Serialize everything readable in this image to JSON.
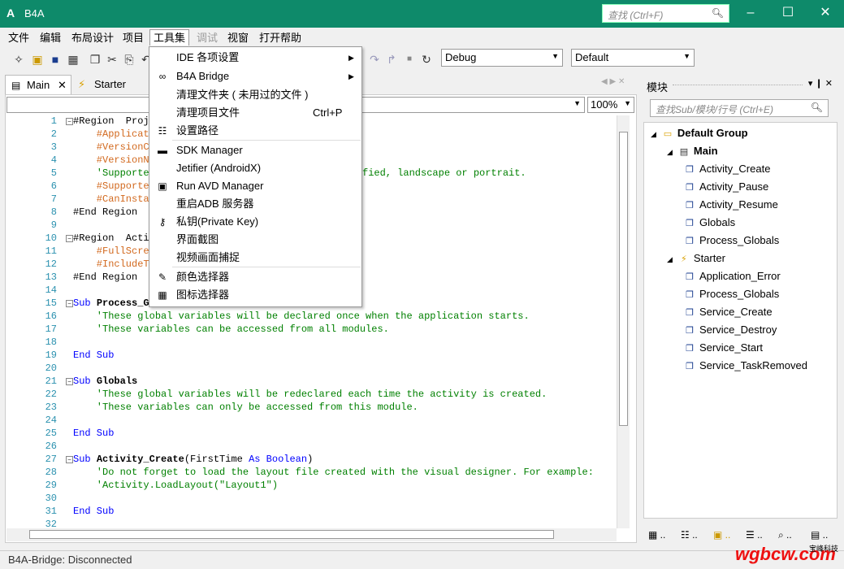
{
  "window": {
    "title": "B4A",
    "app_icon": "A",
    "search_placeholder": "查找 (Ctrl+F)",
    "titlebar_color": "#0e8a6a"
  },
  "menu": [
    "文件",
    "编辑",
    "布局设计",
    "项目",
    "工具集",
    "调试",
    "视窗",
    "打开帮助"
  ],
  "toolbar": {
    "config_combo": "Debug",
    "target_combo": "Default"
  },
  "tabs": {
    "main": "Main",
    "starter": "Starter"
  },
  "editor": {
    "zoom": "100%",
    "line_numbers": [
      "1",
      "2",
      "3",
      "4",
      "5",
      "6",
      "7",
      "8",
      "9",
      "10",
      "11",
      "12",
      "13",
      "14",
      "15",
      "16",
      "17",
      "18",
      "19",
      "20",
      "21",
      "22",
      "23",
      "24",
      "25",
      "26",
      "27",
      "28",
      "29",
      "30",
      "31",
      "32"
    ],
    "lines": [
      {
        "n": 1,
        "parts": [
          [
            "#Region  Proje",
            "c-dir"
          ]
        ]
      },
      {
        "n": 2,
        "parts": [
          [
            "    #Applicat",
            "c-attr"
          ]
        ]
      },
      {
        "n": 3,
        "parts": [
          [
            "    #VersionCo",
            "c-attr"
          ]
        ]
      },
      {
        "n": 4,
        "parts": [
          [
            "    #VersionNa",
            "c-attr"
          ]
        ]
      },
      {
        "n": 5,
        "parts": [
          [
            "    'Supportec",
            "c-comment"
          ]
        ]
      },
      {
        "n": 6,
        "parts": [
          [
            "    #Supportec",
            "c-attr"
          ]
        ]
      },
      {
        "n": 7,
        "parts": [
          [
            "    #CanInstal",
            "c-attr"
          ]
        ]
      },
      {
        "n": 8,
        "parts": [
          [
            "#End Region",
            "c-dir"
          ]
        ]
      },
      {
        "n": 9,
        "parts": []
      },
      {
        "n": 10,
        "parts": [
          [
            "#Region  Activ",
            "c-dir"
          ]
        ]
      },
      {
        "n": 11,
        "parts": [
          [
            "    #FullScree",
            "c-attr"
          ]
        ]
      },
      {
        "n": 12,
        "parts": [
          [
            "    #IncludeTi",
            "c-attr"
          ]
        ]
      },
      {
        "n": 13,
        "parts": [
          [
            "#End Region",
            "c-dir"
          ]
        ]
      },
      {
        "n": 14,
        "parts": []
      },
      {
        "n": 15,
        "parts": [
          [
            "Sub ",
            "c-kw"
          ],
          [
            "Process_Gl",
            "c-bold"
          ]
        ]
      },
      {
        "n": 16,
        "parts": [
          [
            "    'These global variables will be declared once when the application starts.",
            "c-comment"
          ]
        ]
      },
      {
        "n": 17,
        "parts": [
          [
            "    'These variables can be accessed from all modules.",
            "c-comment"
          ]
        ]
      },
      {
        "n": 18,
        "parts": []
      },
      {
        "n": 19,
        "parts": [
          [
            "End Sub",
            "c-kw"
          ]
        ]
      },
      {
        "n": 20,
        "parts": []
      },
      {
        "n": 21,
        "parts": [
          [
            "Sub ",
            "c-kw"
          ],
          [
            "Globals",
            "c-bold"
          ]
        ]
      },
      {
        "n": 22,
        "parts": [
          [
            "    'These global variables will be redeclared each time the activity is created.",
            "c-comment"
          ]
        ]
      },
      {
        "n": 23,
        "parts": [
          [
            "    'These variables can only be accessed from this module.",
            "c-comment"
          ]
        ]
      },
      {
        "n": 24,
        "parts": []
      },
      {
        "n": 25,
        "parts": [
          [
            "End Sub",
            "c-kw"
          ]
        ]
      },
      {
        "n": 26,
        "parts": []
      },
      {
        "n": 27,
        "parts": [
          [
            "Sub ",
            "c-kw"
          ],
          [
            "Activity_Create",
            "c-bold"
          ],
          [
            "(FirstTime ",
            "c-dir"
          ],
          [
            "As ",
            "c-kw"
          ],
          [
            "Boolean",
            "c-kw"
          ],
          [
            ")",
            "c-dir"
          ]
        ]
      },
      {
        "n": 28,
        "parts": [
          [
            "    'Do not forget to load the layout file created with the visual designer. For example:",
            "c-comment"
          ]
        ]
      },
      {
        "n": 29,
        "parts": [
          [
            "    'Activity.LoadLayout(\"Layout1\")",
            "c-comment"
          ]
        ]
      },
      {
        "n": 30,
        "parts": []
      },
      {
        "n": 31,
        "parts": [
          [
            "End Sub",
            "c-kw"
          ]
        ]
      },
      {
        "n": 32,
        "parts": []
      }
    ],
    "line5_tail": "fied, landscape or portrait."
  },
  "tools_menu": [
    {
      "label": "IDE 各项设置",
      "icon": "",
      "shortcut": "",
      "submenu": true
    },
    {
      "label": "B4A Bridge",
      "icon": "link-icon",
      "shortcut": "",
      "submenu": true
    },
    {
      "label": "清理文件夹 ( 未用过的文件 )",
      "icon": "",
      "shortcut": "",
      "submenu": false
    },
    {
      "label": "清理项目文件",
      "icon": "",
      "shortcut": "Ctrl+P",
      "submenu": false
    },
    {
      "label": "设置路径",
      "icon": "path-icon",
      "shortcut": "",
      "submenu": false
    },
    {
      "label": "SDK Manager",
      "icon": "sdk-icon",
      "shortcut": "",
      "submenu": false
    },
    {
      "label": "Jetifier (AndroidX)",
      "icon": "",
      "shortcut": "",
      "submenu": false
    },
    {
      "label": "Run AVD Manager",
      "icon": "avd-icon",
      "shortcut": "",
      "submenu": false
    },
    {
      "label": "重启ADB 服务器",
      "icon": "",
      "shortcut": "",
      "submenu": false
    },
    {
      "label": "私钥(Private Key)",
      "icon": "key-icon",
      "shortcut": "",
      "submenu": false
    },
    {
      "label": "界面截图",
      "icon": "",
      "shortcut": "",
      "submenu": false
    },
    {
      "label": "视频画面捕捉",
      "icon": "",
      "shortcut": "",
      "submenu": false
    },
    {
      "label": "颜色选择器",
      "icon": "color-picker-icon",
      "shortcut": "",
      "submenu": false
    },
    {
      "label": "图标选择器",
      "icon": "icon-picker-icon",
      "shortcut": "",
      "submenu": false
    }
  ],
  "modules_panel": {
    "title": "模块",
    "search_placeholder": "查找Sub/模块/行号 (Ctrl+E)",
    "tree": [
      {
        "label": "Default Group",
        "level": 0,
        "bold": true,
        "icon": "folder-icon"
      },
      {
        "label": "Main",
        "level": 1,
        "bold": true,
        "icon": "activity-module-icon"
      },
      {
        "label": "Activity_Create",
        "level": 2,
        "bold": false,
        "icon": "sub-icon"
      },
      {
        "label": "Activity_Pause",
        "level": 2,
        "bold": false,
        "icon": "sub-icon"
      },
      {
        "label": "Activity_Resume",
        "level": 2,
        "bold": false,
        "icon": "sub-icon"
      },
      {
        "label": "Globals",
        "level": 2,
        "bold": false,
        "icon": "sub-icon"
      },
      {
        "label": "Process_Globals",
        "level": 2,
        "bold": false,
        "icon": "sub-icon"
      },
      {
        "label": "Starter",
        "level": 1,
        "bold": false,
        "icon": "service-module-icon"
      },
      {
        "label": "Application_Error",
        "level": 2,
        "bold": false,
        "icon": "sub-icon"
      },
      {
        "label": "Process_Globals",
        "level": 2,
        "bold": false,
        "icon": "sub-icon"
      },
      {
        "label": "Service_Create",
        "level": 2,
        "bold": false,
        "icon": "sub-icon"
      },
      {
        "label": "Service_Destroy",
        "level": 2,
        "bold": false,
        "icon": "sub-icon"
      },
      {
        "label": "Service_Start",
        "level": 2,
        "bold": false,
        "icon": "sub-icon"
      },
      {
        "label": "Service_TaskRemoved",
        "level": 2,
        "bold": false,
        "icon": "sub-icon"
      }
    ]
  },
  "status": "B4A-Bridge: Disconnected",
  "watermark": {
    "text": "wgbcw.com",
    "small": "宝峰科技"
  }
}
